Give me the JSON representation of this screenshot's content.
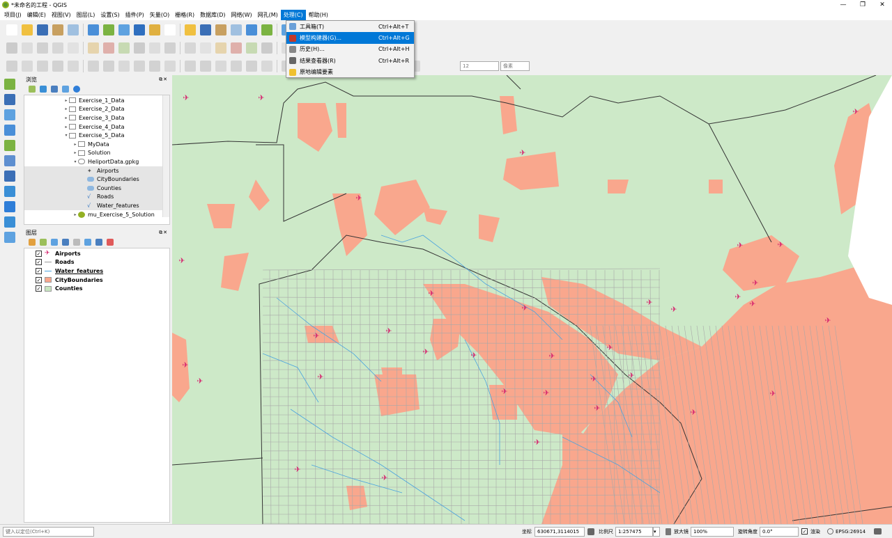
{
  "window": {
    "title": "*未命名的工程 - QGIS",
    "min": "—",
    "restore": "❐",
    "close": "✕"
  },
  "menu": [
    "项目(J)",
    "编辑(E)",
    "视图(V)",
    "图层(L)",
    "设置(S)",
    "插件(P)",
    "矢量(O)",
    "栅格(R)",
    "数据库(D)",
    "网络(W)",
    "网孔(M)",
    "处理(C)",
    "帮助(H)"
  ],
  "processing_menu": [
    {
      "label": "工具箱(T)",
      "shortcut": "Ctrl+Alt+T",
      "icon": "gear-icon"
    },
    {
      "label": "模型构建器(G)...",
      "shortcut": "Ctrl+Alt+G",
      "icon": "model-builder-icon"
    },
    {
      "label": "历史(H)...",
      "shortcut": "Ctrl+Alt+H",
      "icon": "history-icon"
    },
    {
      "label": "结果查看器(R)",
      "shortcut": "Ctrl+Alt+R",
      "icon": "results-icon"
    },
    {
      "label": "原地编辑要素",
      "shortcut": "",
      "icon": "edit-in-place-icon"
    }
  ],
  "toolbar3": {
    "snap_tolerance": "12",
    "snap_unit": "像素"
  },
  "browser": {
    "title": "浏览",
    "items": [
      {
        "label": "Exercise_1_Data",
        "level": 1,
        "type": "folder",
        "arrow": "▸"
      },
      {
        "label": "Exercise_2_Data",
        "level": 1,
        "type": "folder",
        "arrow": "▸"
      },
      {
        "label": "Exercise_3_Data",
        "level": 1,
        "type": "folder",
        "arrow": "▸"
      },
      {
        "label": "Exercise_4_Data",
        "level": 1,
        "type": "folder",
        "arrow": "▸"
      },
      {
        "label": "Exercise_5_Data",
        "level": 1,
        "type": "folder",
        "arrow": "▾"
      },
      {
        "label": "MyData",
        "level": 2,
        "type": "folder",
        "arrow": "▸"
      },
      {
        "label": "Solution",
        "level": 2,
        "type": "folder",
        "arrow": "▸"
      },
      {
        "label": "HeliportData.gpkg",
        "level": 2,
        "type": "gpkg",
        "arrow": "▾"
      },
      {
        "label": "Airports",
        "level": 3,
        "type": "point",
        "arrow": ""
      },
      {
        "label": "CityBoundaries",
        "level": 3,
        "type": "polygon",
        "arrow": ""
      },
      {
        "label": "Counties",
        "level": 3,
        "type": "polygon",
        "arrow": ""
      },
      {
        "label": "Roads",
        "level": 3,
        "type": "line",
        "arrow": ""
      },
      {
        "label": "Water_features",
        "level": 3,
        "type": "line",
        "arrow": ""
      },
      {
        "label": "mu_Exercise_5_Solution",
        "level": 2,
        "type": "project",
        "arrow": "▸"
      }
    ]
  },
  "layers": {
    "title": "图层",
    "items": [
      {
        "label": "Airports",
        "checked": true,
        "underline": false,
        "symbol": "airport",
        "color": "#d6246e"
      },
      {
        "label": "Roads",
        "checked": true,
        "underline": false,
        "symbol": "line",
        "color": "#999999"
      },
      {
        "label": "Water_features",
        "checked": true,
        "underline": true,
        "symbol": "line",
        "color": "#4aa3df"
      },
      {
        "label": "CityBoundaries",
        "checked": true,
        "underline": false,
        "symbol": "fill",
        "color": "#f9a78d"
      },
      {
        "label": "Counties",
        "checked": true,
        "underline": false,
        "symbol": "fill",
        "color": "#c9e7c1"
      }
    ]
  },
  "status": {
    "locator_placeholder": "键入以定位(Ctrl+K)",
    "coord_label": "坐标",
    "coord": "630671,3114015",
    "scale_label": "比例尺",
    "scale": "1:257475",
    "magnifier_label": "放大镜",
    "magnifier": "100%",
    "rotation_label": "旋转角度",
    "rotation": "0.0°",
    "render_label": "渲染",
    "crs": "EPSG:26914"
  },
  "colors": {
    "city": "#f9a78d",
    "county": "#cde9c8",
    "road": "#a8a8a8",
    "water": "#4aa3df",
    "airport": "#d6246e",
    "highlight": "#0078d7"
  }
}
